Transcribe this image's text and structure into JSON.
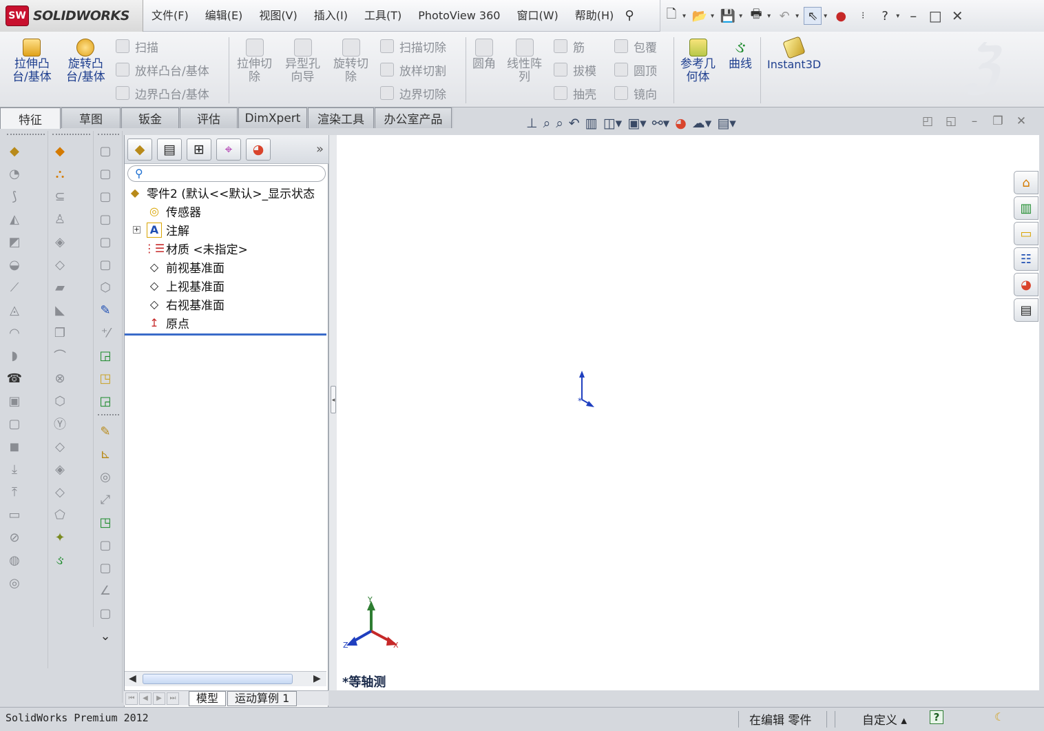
{
  "app": {
    "brand": "SOLIDWORKS",
    "badge": "SW"
  },
  "menu": [
    "文件(F)",
    "编辑(E)",
    "视图(V)",
    "插入(I)",
    "工具(T)",
    "PhotoView 360",
    "窗口(W)",
    "帮助(H)"
  ],
  "ribbon": {
    "extrude_boss": "拉伸凸\n台/基体",
    "revolve_boss": "旋转凸\n台/基体",
    "sweep": "扫描",
    "loft": "放样凸台/基体",
    "boundary": "边界凸台/基体",
    "extrude_cut": "拉伸切\n除",
    "hole_wizard": "异型孔\n向导",
    "revolve_cut": "旋转切\n除",
    "sweep_cut": "扫描切除",
    "loft_cut": "放样切割",
    "boundary_cut": "边界切除",
    "fillet": "圆角",
    "linear_pattern": "线性阵\n列",
    "rib": "筋",
    "draft": "拔模",
    "shell": "抽壳",
    "wrap": "包覆",
    "dome": "圆顶",
    "mirror": "镜向",
    "ref_geometry": "参考几\n何体",
    "curves": "曲线",
    "instant3d": "Instant3D"
  },
  "tabs": [
    "特征",
    "草图",
    "钣金",
    "评估",
    "DimXpert",
    "渲染工具",
    "办公室产品"
  ],
  "tree": {
    "root": "零件2  (默认<<默认>_显示状态",
    "items": [
      "传感器",
      "注解",
      "材质 <未指定>",
      "前视基准面",
      "上视基准面",
      "右视基准面",
      "原点"
    ]
  },
  "fm_footer": {
    "model": "模型",
    "motion": "运动算例 1"
  },
  "viewport": {
    "view_name": "*等轴测"
  },
  "triad": {
    "x": "X",
    "y": "Y",
    "z": "Z"
  },
  "status": {
    "product": "SolidWorks Premium 2012",
    "editing": "在编辑 零件",
    "custom": "自定义 ▴",
    "help": "?"
  },
  "colors": {
    "brand_red": "#c8102e",
    "selection_blue": "#3a6bc9",
    "axis_x": "#c62828",
    "axis_y": "#2e7d32",
    "axis_z": "#1f3fbf"
  }
}
